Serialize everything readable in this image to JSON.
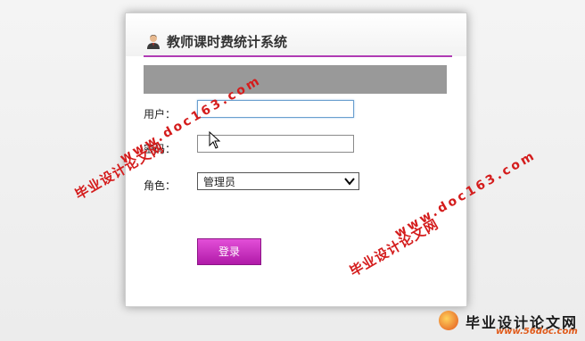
{
  "app": {
    "title": "教师课时费统计系统"
  },
  "form": {
    "username_label": "用户：",
    "username_value": "",
    "password_label": "密码：",
    "password_value": "",
    "role_label": "角色：",
    "role_selected": "管理员",
    "login_button": "登录"
  },
  "watermarks": {
    "site_cn": "毕业设计论文网",
    "url": "www.doc163.com"
  },
  "footer": {
    "site_cn": "毕业设计论文网",
    "url": "www.56doc.com"
  },
  "colors": {
    "accent": "#b03cb4",
    "button": "#c52bbd",
    "watermark": "#d41c1c"
  },
  "icons": {
    "avatar": "user-avatar-icon",
    "dropdown": "chevron-down-icon",
    "cursor": "mouse-cursor-icon"
  }
}
